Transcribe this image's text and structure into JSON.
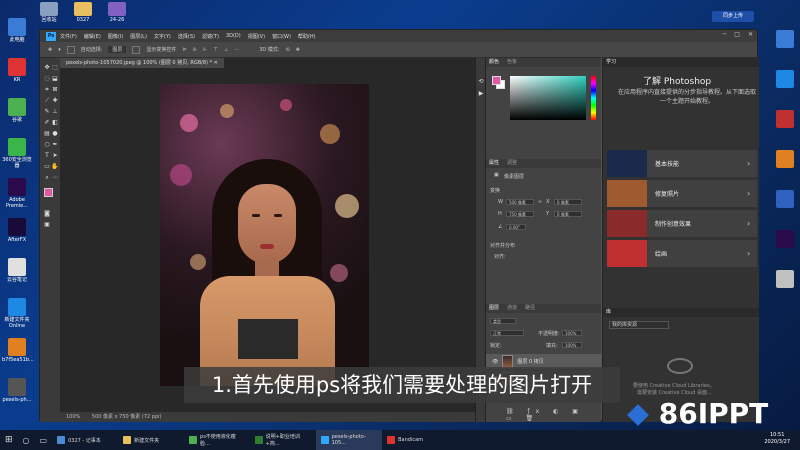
{
  "desktop": {
    "left_icons": [
      {
        "label": "此电脑",
        "color": "#3a7bd5"
      },
      {
        "label": "KR",
        "color": "#d33"
      },
      {
        "label": "谷歌",
        "color": "#4caf50"
      },
      {
        "label": "360安全浏览器",
        "color": "#39b54a"
      },
      {
        "label": "Adobe Premie...",
        "color": "#2a0a4a"
      },
      {
        "label": "AfterFX",
        "color": "#1a0a3a"
      },
      {
        "label": "云谷笔记",
        "color": "#e0e0e0"
      },
      {
        "label": "新建文件夹 Online",
        "color": "#1e88e5"
      },
      {
        "label": "b7f5ea51b...",
        "color": "#e08020"
      },
      {
        "label": "pexels-ph...",
        "color": "#555555"
      }
    ],
    "top_icons": [
      {
        "label": "回收站",
        "color": "#8aa0c0"
      },
      {
        "label": "0327",
        "color": "#e8c060"
      },
      {
        "label": "24-26",
        "color": "#8060c0"
      }
    ],
    "right_icons": [
      {
        "label": "",
        "color": "#3a7bd5"
      },
      {
        "label": "",
        "color": "#1e88e5"
      },
      {
        "label": "",
        "color": "#c03030"
      },
      {
        "label": "",
        "color": "#e08020"
      },
      {
        "label": "",
        "color": "#3060c0"
      },
      {
        "label": "",
        "color": "#2a0a4a"
      },
      {
        "label": "",
        "color": "#c0c0c0"
      }
    ],
    "login_button": "同步上传"
  },
  "photoshop": {
    "logo": "Ps",
    "menu": [
      "文件(F)",
      "编辑(E)",
      "图像(I)",
      "图层(L)",
      "文字(Y)",
      "选择(S)",
      "滤镜(T)",
      "3D(D)",
      "视图(V)",
      "窗口(W)",
      "帮助(H)"
    ],
    "options": {
      "auto_select": "自动选择:",
      "layer_dropdown": "图层",
      "show_transform": "显示变换控件",
      "mode_3d": "3D 模式:"
    },
    "doc_tab": "pexels-photo-1057020.jpeg @ 100% (图层 0 拷贝, RGB/8) *",
    "status": {
      "zoom": "100%",
      "size": "500 像素 x 750 像素 (72 ppi)"
    },
    "color_panel": {
      "tabs": [
        "颜色",
        "色板"
      ],
      "fg": "#e05aa0",
      "bg": "#ffffff"
    },
    "properties": {
      "tabs": [
        "属性",
        "调整"
      ],
      "kind": "像素图层",
      "transform_title": "变换",
      "w_label": "W",
      "w_value": "500 像素",
      "h_label": "H",
      "h_value": "750 像素",
      "x_label": "X",
      "x_value": "0 像素",
      "y_label": "Y",
      "y_value": "0 像素",
      "angle": "0.00°",
      "align_title": "对齐并分布",
      "align_label": "对齐:"
    },
    "layers": {
      "tabs": [
        "图层",
        "通道",
        "路径"
      ],
      "kind": "类型",
      "blend_mode": "正常",
      "opacity_label": "不透明度:",
      "opacity": "100%",
      "lock_label": "锁定:",
      "fill_label": "填充:",
      "fill": "100%",
      "items": [
        {
          "name": "图层 0 拷贝",
          "selected": true
        },
        {
          "name": "图层 0",
          "selected": false
        }
      ]
    },
    "learn": {
      "tab": "学习",
      "title": "了解 Photoshop",
      "desc": "在应用程序内直接提供的分步指导教程。从下面选取一个主题开始教程。",
      "cards": [
        "基本技能",
        "修复照片",
        "制作创意效果",
        "绘画"
      ]
    },
    "library": {
      "tab": "库",
      "dropdown": "我的库资源",
      "cloud_text1": "要使用 Creative Cloud Libraries，",
      "cloud_text2": "需要安装 Creative Cloud 桌面..."
    }
  },
  "subtitle": "1.首先使用ps将我们需要处理的图片打开",
  "brand": "86IPPT",
  "taskbar": {
    "search_icon": "search-icon",
    "items": [
      {
        "label": "0327 - 记事本",
        "color": "#4c8bd8"
      },
      {
        "label": "新建文件夹",
        "color": "#e8c060"
      },
      {
        "label": "ps不使用液化瘦脸...",
        "color": "#4caf50"
      },
      {
        "label": "说明+职业培训+简...",
        "color": "#2e7d32"
      },
      {
        "label": "pexels-photo-105...",
        "color": "#31a8ff"
      },
      {
        "label": "Bandicam",
        "color": "#d33"
      }
    ],
    "time": "10:51",
    "date": "2020/3/27"
  }
}
